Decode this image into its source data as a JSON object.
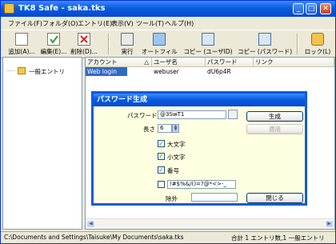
{
  "window": {
    "title": "TK8 Safe - saka.tks",
    "minimize": "_",
    "maximize": "□",
    "close": "✕"
  },
  "menu": [
    "ファイル(F)",
    "フォルダ(O)",
    "エントリ(E)",
    "表示(V)",
    "ツール(T)",
    "ヘルプ(H)"
  ],
  "toolbar": {
    "add": "追加(A)...",
    "edit": "編集(E)...",
    "delete": "削除(D)...",
    "run": "実行",
    "autofill": "オートフィル",
    "copy_user": "コピー (ユーザID)",
    "copy_password": "コピー (パスワード)",
    "lock": "ロック(L)"
  },
  "tree": {
    "root_label": "一般エントリ"
  },
  "table": {
    "columns": [
      "アカウント",
      "ユーザ名",
      "パスワード",
      "リンク"
    ],
    "sort_indicator": "△",
    "rows": [
      {
        "account": "Web login",
        "user": "webuser",
        "password": "dU6p4R",
        "link": ""
      }
    ]
  },
  "dialog": {
    "title": "パスワード生成",
    "password_label": "パスワード",
    "password_value": "@3SwT1",
    "length_label": "長さ",
    "length_value": "6",
    "uppercase_label": "大文字",
    "uppercase_checked": true,
    "lowercase_label": "小文字",
    "lowercase_checked": true,
    "digits_label": "番号",
    "digits_checked": true,
    "symbols_value": "!#$%&/()=?@*<>-_",
    "symbols_checked": false,
    "exclude_label": "除外",
    "exclude_value": "",
    "generate_button": "生成",
    "apply_button": "適用",
    "close_button": "閉じる"
  },
  "status": {
    "path": "C:\\Documents and Settings\\Taisuke\\My Documents\\saka.tks",
    "summary": "合計 1 エントリ数,1 一般エントリ"
  },
  "colors": {
    "titlebar": "#0A5BE0",
    "selection": "#316AC5",
    "dialog_bg": "#FFFFE1"
  }
}
